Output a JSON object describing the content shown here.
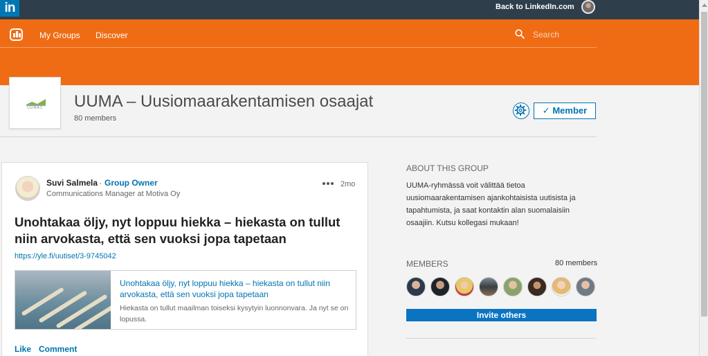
{
  "topbar": {
    "logo": "in",
    "back_link": "Back to LinkedIn.com"
  },
  "nav": {
    "my_groups": "My Groups",
    "discover": "Discover",
    "search_placeholder": "Search"
  },
  "group": {
    "title": "UUMA – Uusiomaarakentamisen osaajat",
    "members": "80 members",
    "logo_text": "UUMA2",
    "member_button": "Member",
    "member_check": "✓"
  },
  "post": {
    "author_name": "Suvi Salmela",
    "author_separator": "·",
    "author_role": "Group Owner",
    "author_subtitle": "Communications Manager at Motiva Oy",
    "time": "2mo",
    "title": "Unohtakaa öljy, nyt loppuu hiekka – hiekasta on tullut niin arvokasta, että sen vuoksi jopa tapetaan",
    "url": "https://yle.fi/uutiset/3-9745042",
    "preview_title": "Unohtakaa öljy, nyt loppuu hiekka – hiekasta on tullut niin arvokasta, että sen vuoksi jopa tapetaan",
    "preview_description": "Hiekasta on tullut maailman toiseksi kysytyin luonnonvara. Ja nyt se on lopussa.",
    "like_label": "Like",
    "comment_label": "Comment"
  },
  "sidebar": {
    "about_title": "ABOUT THIS GROUP",
    "about_text": "UUMA-ryhmässä voit välittää tietoa uusiomaarakentamisen ajankohtaisista uutisista ja tapahtumista, ja saat kontaktin alan suomalaisiin osaajiin. Kutsu kollegasi mukaan!",
    "members_title": "MEMBERS",
    "members_count": "80 members",
    "invite_label": "Invite others"
  },
  "colors": {
    "topbar": "#2f3e4b",
    "brand_orange": "#f06c14",
    "link_blue": "#0073b1",
    "invite_blue": "#0a74c2"
  }
}
